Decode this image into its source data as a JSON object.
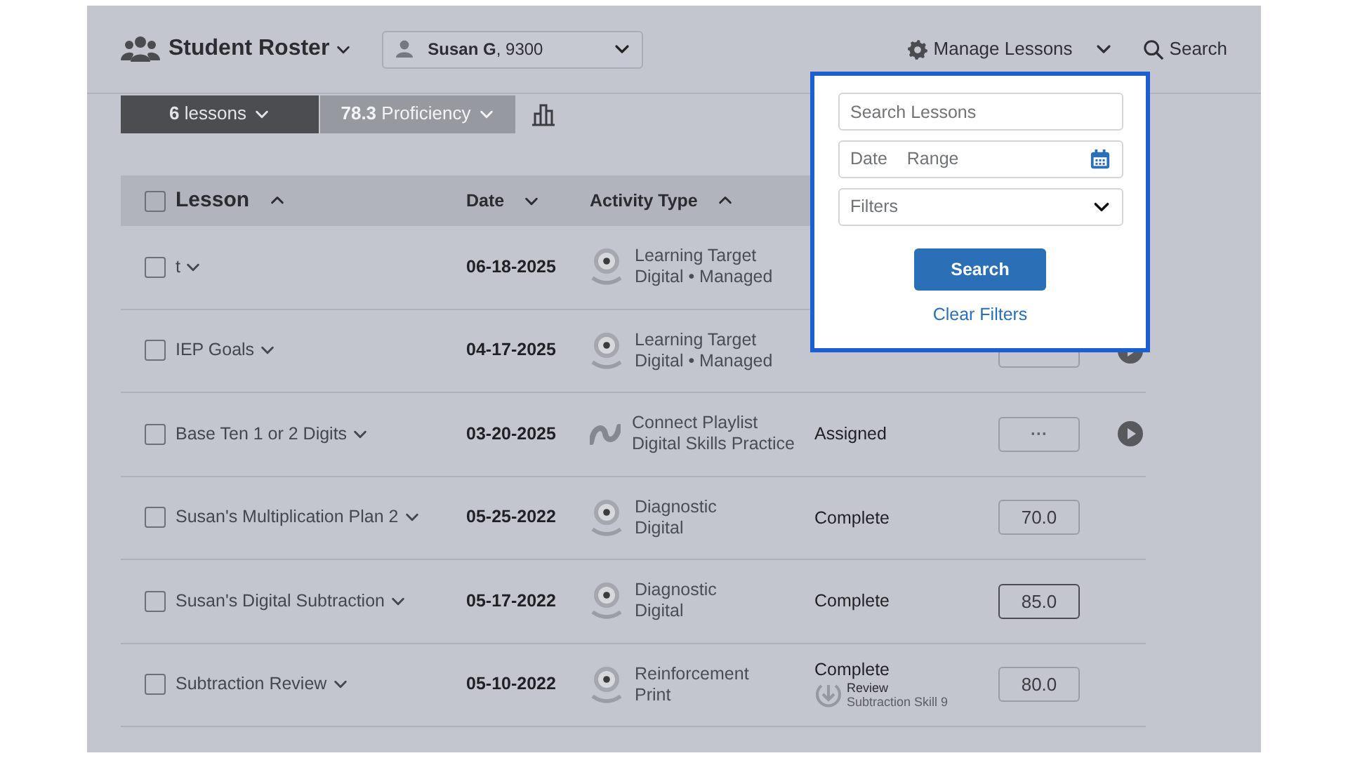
{
  "header": {
    "title": "Student Roster",
    "student": "**Susan G**, 9300",
    "manage": "Manage Lessons",
    "search": "Search"
  },
  "summary": {
    "lessons": "**6** lessons",
    "proficiency": "**78.3** Proficiency"
  },
  "table": {
    "select_all": {
      "checked": false
    },
    "columns": [
      {
        "label": "Lesson",
        "ascending": true
      },
      {
        "label": "Date",
        "ascending": false
      },
      {
        "label": "Activity Type",
        "ascending": true
      }
    ],
    "rows": [
      {
        "checked": false,
        "lesson": "t",
        "date": "06-18-2025",
        "kind": "target",
        "activity": "Learning Target",
        "activity_sub": "Digital • Managed"
      },
      {
        "checked": false,
        "lesson": "IEP Goals",
        "date": "04-17-2025",
        "kind": "target",
        "activity": "Learning Target",
        "activity_sub": "Digital • Managed",
        "pending": true,
        "score_selected": false,
        "play": true
      },
      {
        "checked": false,
        "lesson": "Base Ten 1 or 2 Digits",
        "date": "03-20-2025",
        "kind": "playlist",
        "activity": "Connect Playlist",
        "activity_sub": "Digital Skills Practice",
        "status": "Assigned",
        "pending": true,
        "score": "···",
        "score_selected": false,
        "play": true
      },
      {
        "checked": false,
        "lesson": "Susan's Multiplication Plan 2",
        "date": "05-25-2022",
        "kind": "target",
        "activity": "Diagnostic",
        "activity_sub": "Digital",
        "status": "Complete",
        "pending": false,
        "score": "70.0",
        "score_selected": false,
        "play": false
      },
      {
        "checked": false,
        "lesson": "Susan's Digital Subtraction",
        "date": "05-17-2022",
        "kind": "target",
        "activity": "Diagnostic",
        "activity_sub": "Digital",
        "status": "Complete",
        "pending": false,
        "score": "85.0",
        "score_selected": true,
        "play": false
      },
      {
        "checked": false,
        "lesson": "Subtraction Review",
        "date": "05-10-2022",
        "kind": "target",
        "activity": "Reinforcement",
        "activity_sub": "Print",
        "status": "Complete",
        "review": {
          "label": "Review",
          "detail": "Subtraction Skill 9"
        },
        "pending": false,
        "score": "80.0",
        "score_selected": false,
        "play": false
      }
    ]
  },
  "popup": {
    "search_placeholder": "Search Lessons",
    "date_start": "Date",
    "date_end": "Range",
    "filters": "Filters",
    "search_button": "Search",
    "clear": "Clear Filters"
  }
}
